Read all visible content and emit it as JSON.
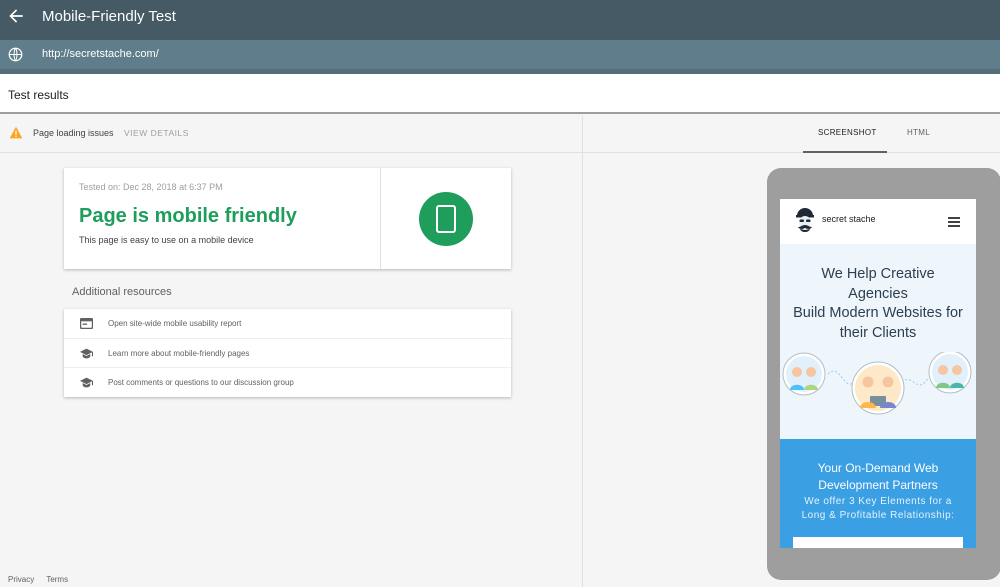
{
  "header": {
    "back_icon": "arrow-back-icon",
    "title": "Mobile-Friendly Test"
  },
  "url_bar": {
    "icon": "globe-icon",
    "url": "http://secretstache.com/"
  },
  "results": {
    "title": "Test results"
  },
  "issues": {
    "icon": "warning-icon",
    "label": "Page loading issues",
    "details_link": "VIEW DETAILS"
  },
  "result_card": {
    "tested_on": "Tested on: Dec 28, 2018 at 6:37 PM",
    "verdict": "Page is mobile friendly",
    "description": "This page is easy to use on a mobile device",
    "icon": "mobile-phone-icon",
    "accent_color": "#1e9e5a"
  },
  "additional": {
    "heading": "Additional resources",
    "items": [
      {
        "icon": "report-icon",
        "label": "Open site-wide mobile usability report"
      },
      {
        "icon": "school-icon",
        "label": "Learn more about mobile-friendly pages"
      },
      {
        "icon": "school-icon",
        "label": "Post comments or questions to our discussion group"
      }
    ]
  },
  "footer": {
    "privacy": "Privacy",
    "terms": "Terms"
  },
  "tabs": {
    "screenshot": "SCREENSHOT",
    "html": "HTML",
    "active": "screenshot"
  },
  "preview": {
    "site_name": "secret stache",
    "hero_line1": "We Help Creative",
    "hero_line2": "Agencies",
    "hero_line3": "Build Modern Websites for",
    "hero_line4": "their Clients",
    "blue_line1": "Your On-Demand Web",
    "blue_line2": "Development Partners",
    "blue_sub1": "We offer 3 Key Elements for a",
    "blue_sub2": "Long & Profitable Relationship:"
  },
  "colors": {
    "header_bg": "#455a64",
    "url_bg": "#607d8b",
    "success": "#1e9e5a",
    "preview_blue": "#3b9fe3"
  }
}
